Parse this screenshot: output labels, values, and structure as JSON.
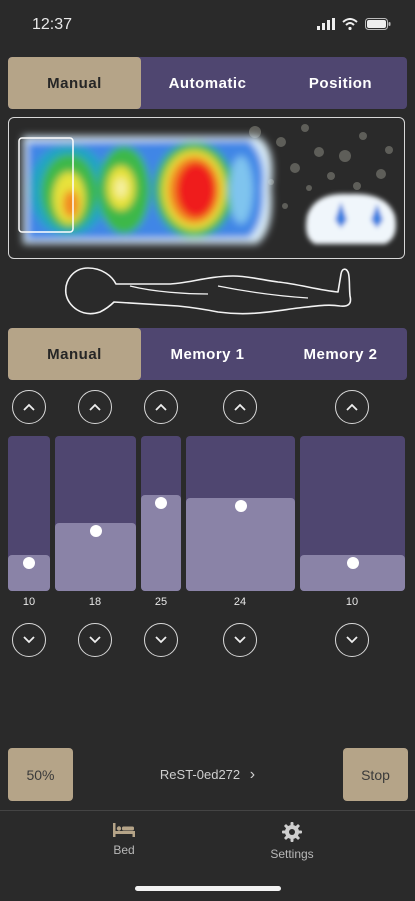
{
  "status": {
    "time": "12:37"
  },
  "mode_tabs": [
    {
      "label": "Manual",
      "active": true
    },
    {
      "label": "Automatic",
      "active": false
    },
    {
      "label": "Position",
      "active": false
    }
  ],
  "memory_tabs": [
    {
      "label": "Manual",
      "active": true
    },
    {
      "label": "Memory 1",
      "active": false
    },
    {
      "label": "Memory 2",
      "active": false
    }
  ],
  "sections": [
    {
      "value": "10",
      "level": 0.23
    },
    {
      "value": "18",
      "level": 0.44
    },
    {
      "value": "25",
      "level": 0.62
    },
    {
      "value": "24",
      "level": 0.6
    },
    {
      "value": "10",
      "level": 0.23
    }
  ],
  "controls": {
    "percent_label": "50%",
    "device_name": "ReST-0ed272",
    "device_chevron": "›",
    "stop_label": "Stop"
  },
  "tabbar": {
    "bed_label": "Bed",
    "settings_label": "Settings"
  },
  "colors": {
    "accent": "#b5a488",
    "purple": "#4f4670",
    "purple_fill": "#8a83a7",
    "background": "#2a2a2a"
  },
  "icons": [
    "signal-icon",
    "wifi-icon",
    "battery-icon",
    "chevron-up-icon",
    "chevron-down-icon",
    "bed-icon",
    "gear-icon",
    "chevron-right-icon"
  ]
}
